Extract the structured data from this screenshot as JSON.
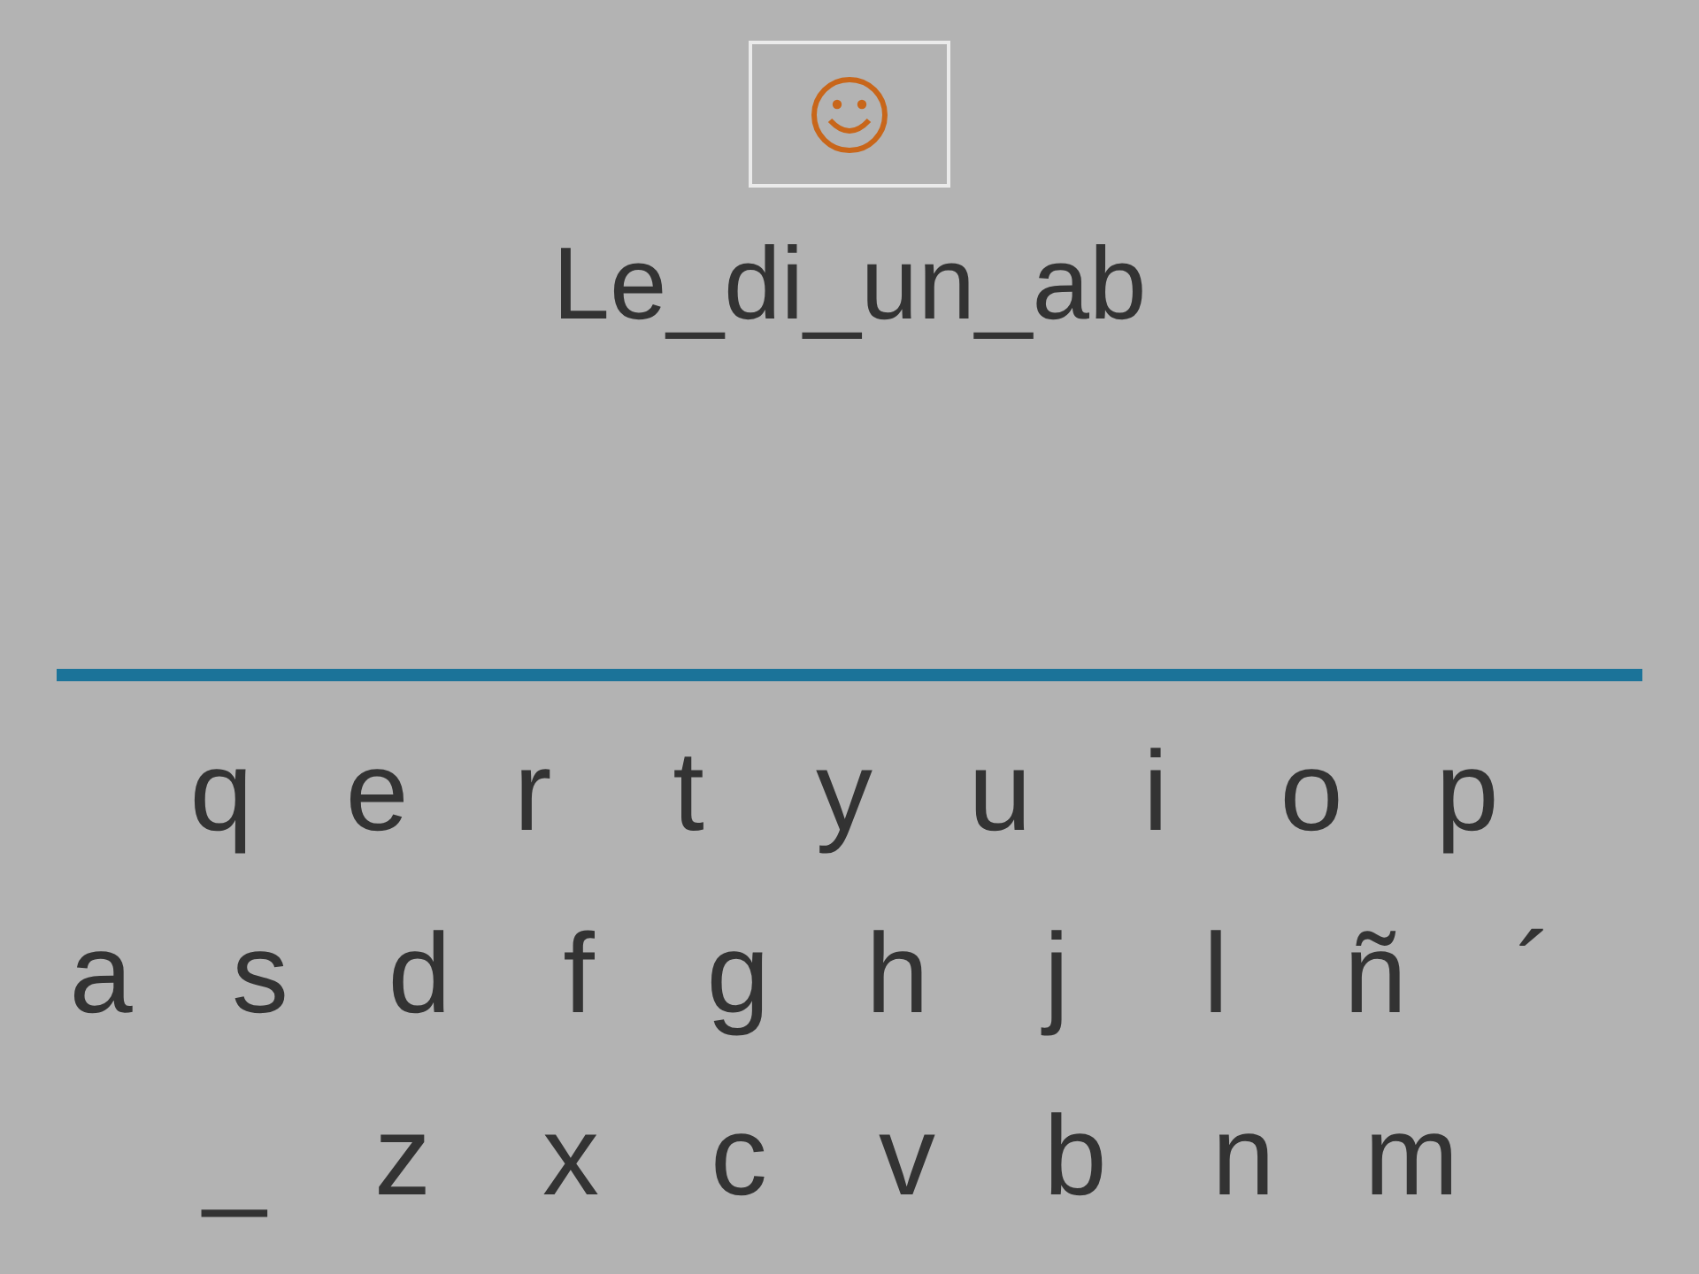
{
  "feedback": {
    "kind": "smiley"
  },
  "word": "Le_di_un_ab",
  "keyboard": {
    "rows": [
      [
        "q",
        "e",
        "r",
        "t",
        "y",
        "u",
        "i",
        "o",
        "p"
      ],
      [
        "a",
        "s",
        "d",
        "f",
        "g",
        "h",
        "j",
        "l",
        "ñ",
        "´"
      ],
      [
        "_",
        "z",
        "x",
        "c",
        "v",
        "b",
        "n",
        "m"
      ]
    ]
  }
}
